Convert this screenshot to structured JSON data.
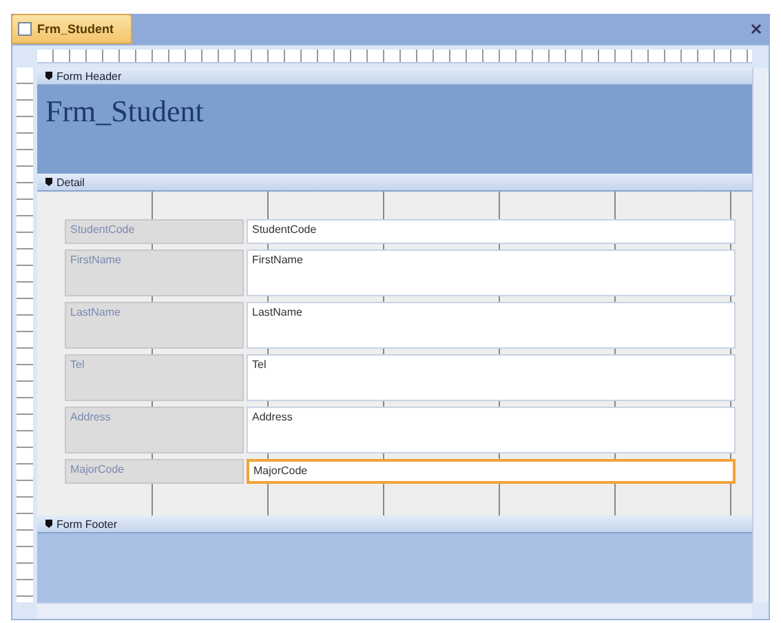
{
  "tab": {
    "title": "Frm_Student"
  },
  "sections": [
    {
      "title": "Form Header"
    },
    {
      "title": "Detail"
    },
    {
      "title": "Form Footer"
    }
  ],
  "header": {
    "title": "Frm_Student"
  },
  "fields": [
    {
      "label": "StudentCode",
      "value": "StudentCode",
      "selected": false
    },
    {
      "label": "FirstName",
      "value": "FirstName",
      "selected": false
    },
    {
      "label": "LastName",
      "value": "LastName",
      "selected": false
    },
    {
      "label": "Tel",
      "value": "Tel",
      "selected": false
    },
    {
      "label": "Address",
      "value": "Address",
      "selected": false
    },
    {
      "label": "MajorCode",
      "value": "MajorCode",
      "selected": true
    }
  ]
}
